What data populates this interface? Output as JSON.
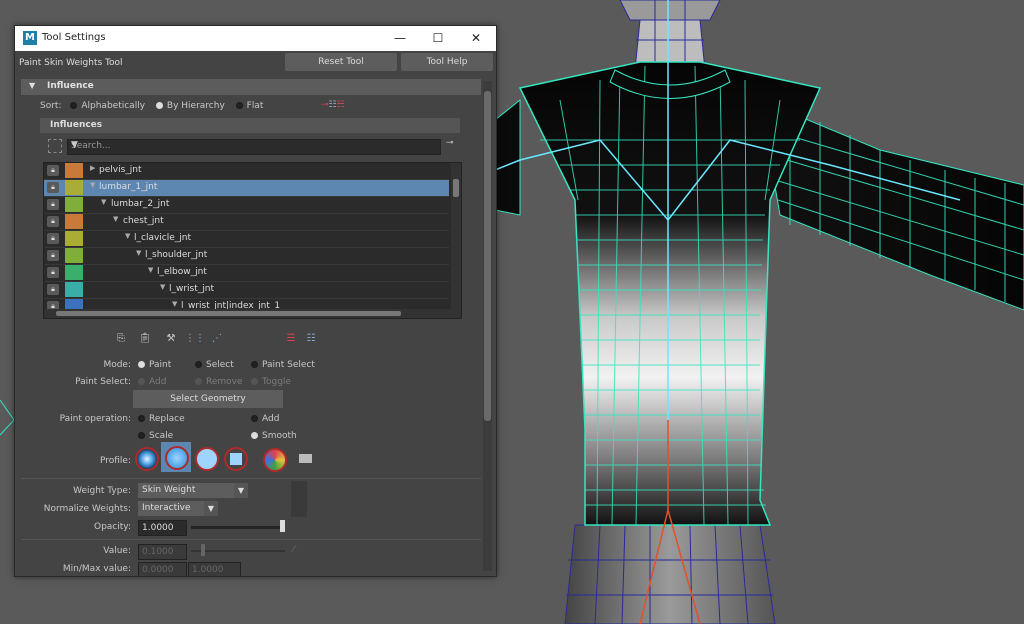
{
  "window": {
    "title": "Tool Settings",
    "logo": "M",
    "minimize": "—",
    "maximize": "☐",
    "close": "✕"
  },
  "toolbar": {
    "tool_name": "Paint Skin Weights Tool",
    "reset_label": "Reset Tool",
    "help_label": "Tool Help"
  },
  "influence": {
    "section_label": "Influence",
    "sort_label": "Sort:",
    "sort_options": [
      "Alphabetically",
      "By Hierarchy",
      "Flat"
    ],
    "sort_selected": "By Hierarchy",
    "influences_label": "Influences",
    "search_placeholder": "Search...",
    "joints": [
      {
        "name": "pelvis_jnt",
        "color": "#c87a3a",
        "selected": false
      },
      {
        "name": "lumbar_1_jnt",
        "color": "#a9ad36",
        "selected": true
      },
      {
        "name": "lumbar_2_jnt",
        "color": "#7fae3a",
        "selected": false
      },
      {
        "name": "chest_jnt",
        "color": "#c87a3a",
        "selected": false
      },
      {
        "name": "l_clavicle_jnt",
        "color": "#a9ad36",
        "selected": false
      },
      {
        "name": "l_shoulder_jnt",
        "color": "#7fae3a",
        "selected": false
      },
      {
        "name": "l_elbow_jnt",
        "color": "#3aae6a",
        "selected": false
      },
      {
        "name": "l_wrist_jnt",
        "color": "#3aaea6",
        "selected": false
      },
      {
        "name": "l_wrist_jnt|index_jnt_1",
        "color": "#3a72c0",
        "selected": false
      }
    ]
  },
  "paint": {
    "mode_label": "Mode:",
    "mode_options": [
      "Paint",
      "Select",
      "Paint Select"
    ],
    "paint_select_label": "Paint Select:",
    "paint_select_options": [
      "Add",
      "Remove",
      "Toggle"
    ],
    "select_geometry_label": "Select Geometry",
    "operation_label": "Paint operation:",
    "operations": [
      "Replace",
      "Add",
      "Scale",
      "Smooth"
    ],
    "profile_label": "Profile:",
    "weight_type_label": "Weight Type:",
    "weight_type_value": "Skin Weight",
    "normalize_label": "Normalize Weights:",
    "normalize_value": "Interactive",
    "opacity_label": "Opacity:",
    "opacity_value": "1.0000",
    "value_label": "Value:",
    "value_value": "0.1000",
    "minmax_label": "Min/Max value:",
    "min_value": "0.0000",
    "max_value": "1.0000"
  }
}
